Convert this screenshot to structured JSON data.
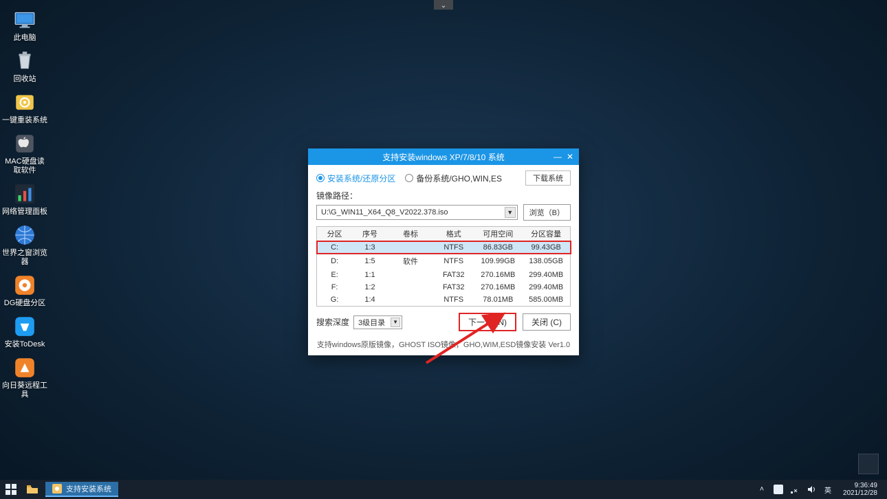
{
  "top_notch_glyph": "⌄",
  "desktop": {
    "icons": [
      {
        "label": "此电脑"
      },
      {
        "label": "回收站"
      },
      {
        "label": "一键重装系统"
      },
      {
        "label": "MAC硬盘读取软件"
      },
      {
        "label": "网络管理面板"
      },
      {
        "label": "世界之窗浏览器"
      },
      {
        "label": "DG硬盘分区"
      },
      {
        "label": "安装ToDesk"
      },
      {
        "label": "向日葵远程工具"
      }
    ]
  },
  "dialog": {
    "title": "支持安装windows XP/7/8/10 系统",
    "radio1": "安装系统/还原分区",
    "radio2": "备份系统/GHO,WIN,ES",
    "download_btn": "下载系统",
    "image_path_label": "镜像路径：",
    "image_path_value": "U:\\G_WIN11_X64_Q8_V2022.378.iso",
    "browse": "浏览（B）",
    "columns": [
      "分区",
      "序号",
      "卷标",
      "格式",
      "可用空间",
      "分区容量"
    ],
    "rows": [
      {
        "drive": "C:",
        "idx": "1:3",
        "label": "",
        "fmt": "NTFS",
        "free": "86.83GB",
        "total": "99.43GB"
      },
      {
        "drive": "D:",
        "idx": "1:5",
        "label": "软件",
        "fmt": "NTFS",
        "free": "109.99GB",
        "total": "138.05GB"
      },
      {
        "drive": "E:",
        "idx": "1:1",
        "label": "",
        "fmt": "FAT32",
        "free": "270.16MB",
        "total": "299.40MB"
      },
      {
        "drive": "F:",
        "idx": "1:2",
        "label": "",
        "fmt": "FAT32",
        "free": "270.16MB",
        "total": "299.40MB"
      },
      {
        "drive": "G:",
        "idx": "1:4",
        "label": "",
        "fmt": "NTFS",
        "free": "78.01MB",
        "total": "585.00MB"
      }
    ],
    "depth_label": "搜索深度",
    "depth_value": "3级目录",
    "next": "下一步 (N)",
    "close": "关闭 (C)",
    "footer": "支持windows原版镜像，GHOST ISO镜像，GHO,WIM,ESD镜像安装 Ver1.0"
  },
  "taskbar": {
    "app_label": "支持安装系统",
    "time": "9:36:49",
    "date": "2021/12/28"
  }
}
